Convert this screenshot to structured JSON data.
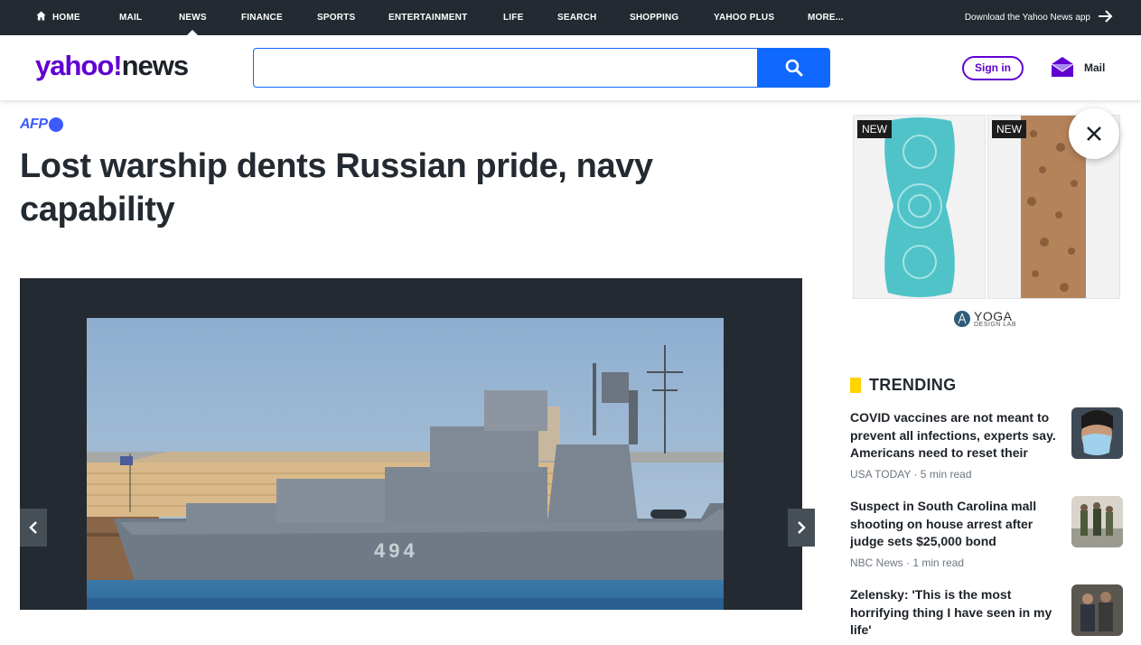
{
  "topnav": {
    "items": [
      {
        "label": "HOME"
      },
      {
        "label": "MAIL"
      },
      {
        "label": "NEWS"
      },
      {
        "label": "FINANCE"
      },
      {
        "label": "SPORTS"
      },
      {
        "label": "ENTERTAINMENT"
      },
      {
        "label": "LIFE"
      },
      {
        "label": "SEARCH"
      },
      {
        "label": "SHOPPING"
      },
      {
        "label": "YAHOO PLUS"
      },
      {
        "label": "MORE..."
      }
    ],
    "active": "NEWS",
    "download_app": "Download the Yahoo News app"
  },
  "header": {
    "logo_yahoo": "yahoo!",
    "logo_news": "news",
    "search_value": "",
    "signin_label": "Sign in",
    "mail_label": "Mail"
  },
  "article": {
    "source": "AFP",
    "headline": "Lost warship dents Russian pride, navy capability",
    "ship_number": "494"
  },
  "ad": {
    "badge_1": "NEW",
    "badge_2": "NEW",
    "brand_name": "YOGA",
    "brand_sub": "DESIGN LAB"
  },
  "trending": {
    "title": "TRENDING",
    "items": [
      {
        "title": "COVID vaccines are not meant to prevent all infections, experts say. Americans need to reset their expectations.",
        "meta": "USA TODAY · 5 min read"
      },
      {
        "title": "Suspect in South Carolina mall shooting on house arrest after judge sets $25,000 bond",
        "meta": "NBC News · 1 min read"
      },
      {
        "title": "Zelensky: 'This is the most horrifying thing I have seen in my life'",
        "meta": ""
      }
    ]
  },
  "colors": {
    "brand_purple": "#6001d2",
    "search_blue": "#0f69ff",
    "nav_bg": "#232a31",
    "afp_blue": "#3d5bfb",
    "trending_yellow": "#ffd400"
  }
}
